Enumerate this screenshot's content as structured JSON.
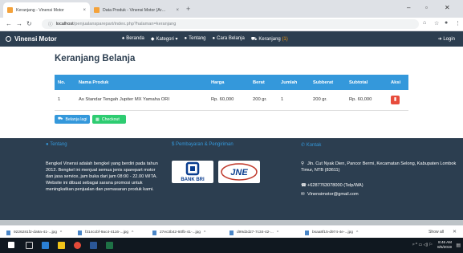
{
  "browser": {
    "tabs": [
      {
        "title": "Keranjang - Vinensi Motor",
        "active": true
      },
      {
        "title": "Data Produk - Vinensi Motor (Ar…",
        "active": false
      }
    ],
    "url_host": "localhost",
    "url_path": "/penjualansparepart/index.php?halaman=keranjang"
  },
  "site": {
    "brand": "Vinensi Motor",
    "menu": [
      {
        "icon": "home-icon",
        "label": "Beranda"
      },
      {
        "icon": "tag-icon",
        "label": "Kategori"
      },
      {
        "icon": "info-icon",
        "label": "Tentang"
      },
      {
        "icon": "question-icon",
        "label": "Cara Belanja"
      },
      {
        "icon": "cart-icon",
        "label": "Keranjang",
        "count": "(1)"
      }
    ],
    "login": "Login"
  },
  "page": {
    "title": "Keranjang Belanja"
  },
  "cart": {
    "headers": [
      "No.",
      "Nama Produk",
      "Harga",
      "Berat",
      "Jumlah",
      "Subberat",
      "Subtotal",
      "Aksi"
    ],
    "rows": [
      {
        "no": "1",
        "nama": "As Standar Tengah Jupiter MX Yamaha ORI",
        "harga": "Rp. 60,000",
        "berat": "200 gr.",
        "jumlah": "1",
        "subberat": "200 gr.",
        "subtotal": "Rp. 60,000"
      }
    ],
    "btn_belanja": "Belanja lagi",
    "btn_checkout": "Checkout"
  },
  "footer": {
    "tentang_heading": "Tentang",
    "tentang_text": "Bengkel Vinensi adalah bengkel yang berdiri pada tahun 2012. Bengkel ini menjual semua jenis sparepart motor dan jasa service, jam buka dari jam 08:00 - 22.00 WITA. Website ini dibuat sebagai sarana promosi untuk meningkatkan penjualan dan pemasaran produk kami.",
    "pembayaran_heading": "Pembayaran & Pengiriman",
    "bank_logo": "BANK BRI",
    "courier_logo": "JNE",
    "kontak_heading": "Kontak",
    "address": "Jln. Cut Nyak Dien, Pancor Bermi, Kecamatan Selong, Kabupaten Lombok Timur, NTB (83611)",
    "phone": "+6287763078000 (Telp/WA)",
    "email": "Vinensimotor@gmail.com"
  },
  "downloads": {
    "items": [
      "9226281f2-da9a-41-...jpg",
      "f314ccbf-9ac4-4116-...jpg",
      "27ec3b42-60fb-41-...jpg",
      "d99d2d27-7c34-42-...",
      "bsaa8f15-d974-4e-...jpg"
    ],
    "show_all": "Show all"
  },
  "taskbar": {
    "time": "8:46 AM",
    "date": "8/5/2019"
  }
}
